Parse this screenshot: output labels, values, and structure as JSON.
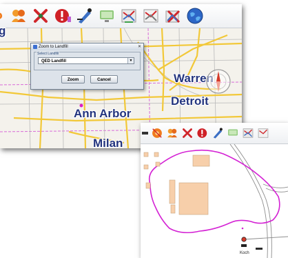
{
  "colors": {
    "road_major": "#f2c838",
    "road_minor": "#b9b9b9",
    "boundary": "#d86ad8",
    "landfill_outline": "#d422d4",
    "parcel_fill": "#f7cfaa",
    "parcel_stroke": "#c8a47f",
    "label": "#23347e"
  },
  "toolbar_icons": [
    "zoom-to-landfill-icon",
    "people-icon",
    "delete-x-icon",
    "alert-icon",
    "pen-tool-icon",
    "monitor-icon",
    "layer-filter-icon",
    "layer-filter-icon-2",
    "remove-layer-icon",
    "globe-icon"
  ],
  "map1": {
    "partial_label": "g",
    "cities": [
      "Warren",
      "Detroit",
      "Ann Arbor",
      "Milan"
    ]
  },
  "dialog": {
    "title": "Zoom to Landfill",
    "group_label": "Select Landfill",
    "selected_landfill": "QED Landfill",
    "zoom_button": "Zoom",
    "cancel_button": "Cancel"
  },
  "map2": {
    "bottom_label": "Koch"
  }
}
